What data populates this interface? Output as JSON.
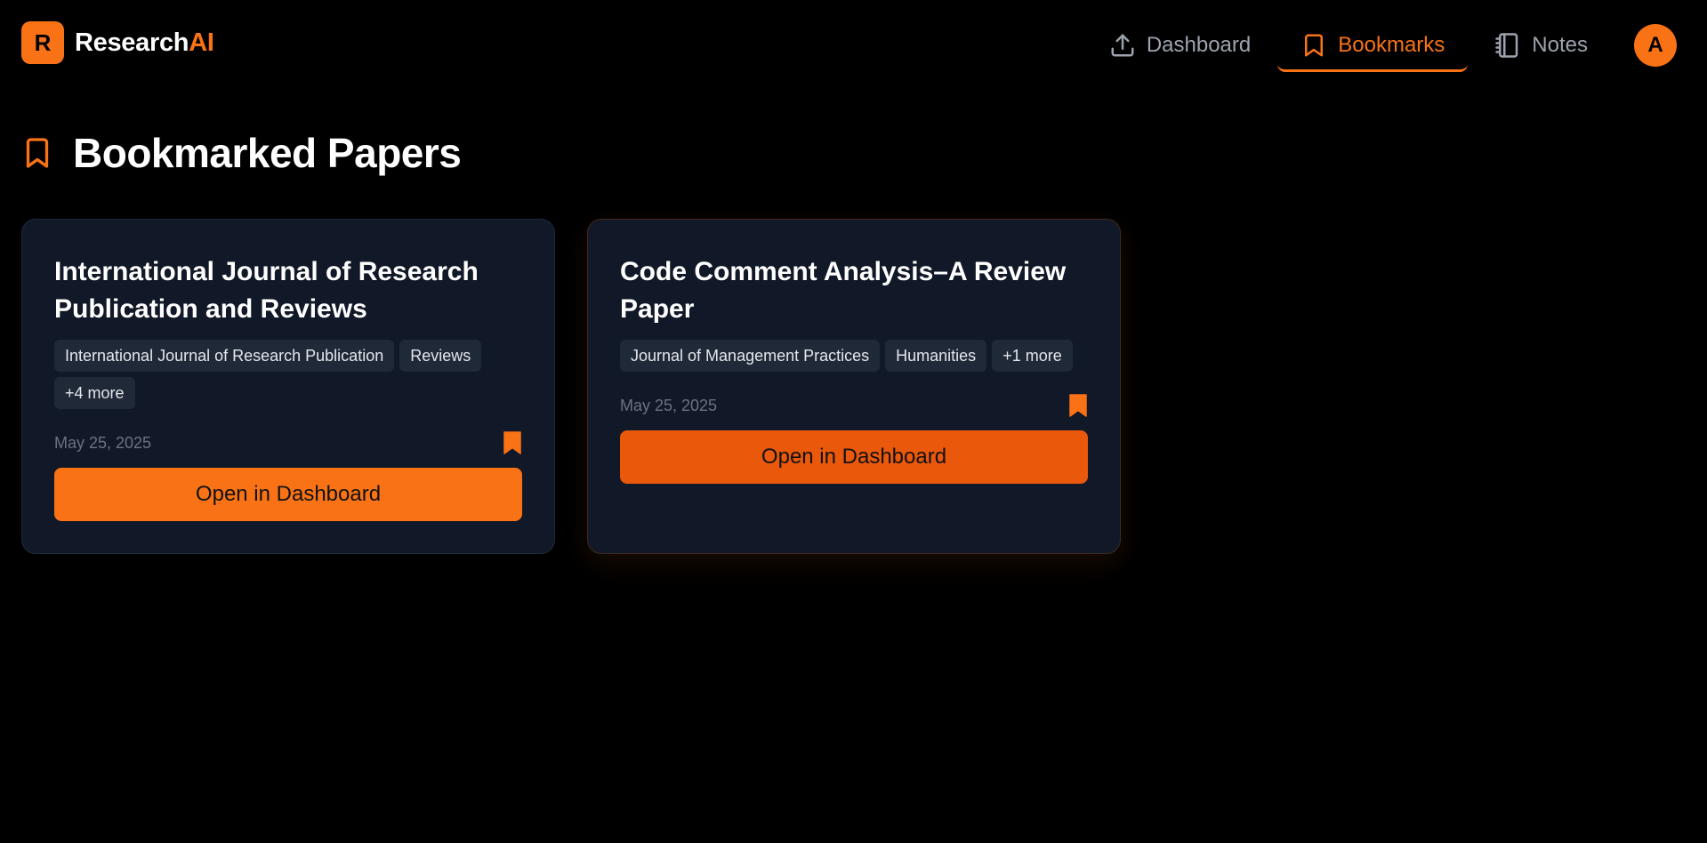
{
  "brand": {
    "logo_letter": "R",
    "name_main": "Research",
    "name_accent": "AI"
  },
  "nav": {
    "items": [
      {
        "label": "Dashboard",
        "icon": "upload-icon",
        "active": false
      },
      {
        "label": "Bookmarks",
        "icon": "bookmark-icon",
        "active": true
      },
      {
        "label": "Notes",
        "icon": "notebook-icon",
        "active": false
      }
    ],
    "avatar_letter": "A"
  },
  "page": {
    "title": "Bookmarked Papers",
    "icon": "bookmark-icon"
  },
  "cards": [
    {
      "title": "International Journal of Research Publication and Reviews",
      "tags": [
        "International Journal of Research Publication",
        "Reviews",
        "+4 more"
      ],
      "date": "May 25, 2025",
      "bookmarked": true,
      "action_label": "Open in Dashboard"
    },
    {
      "title": "Code Comment Analysis–A Review Paper",
      "tags": [
        "Journal of Management Practices",
        "Humanities",
        "+1 more"
      ],
      "date": "May 25, 2025",
      "bookmarked": true,
      "action_label": "Open in Dashboard"
    }
  ],
  "colors": {
    "accent": "#f97316",
    "accent_dark": "#ea580c",
    "background": "#000000",
    "card": "#111827",
    "tag": "#1f2937",
    "muted_text": "#6b7280"
  }
}
